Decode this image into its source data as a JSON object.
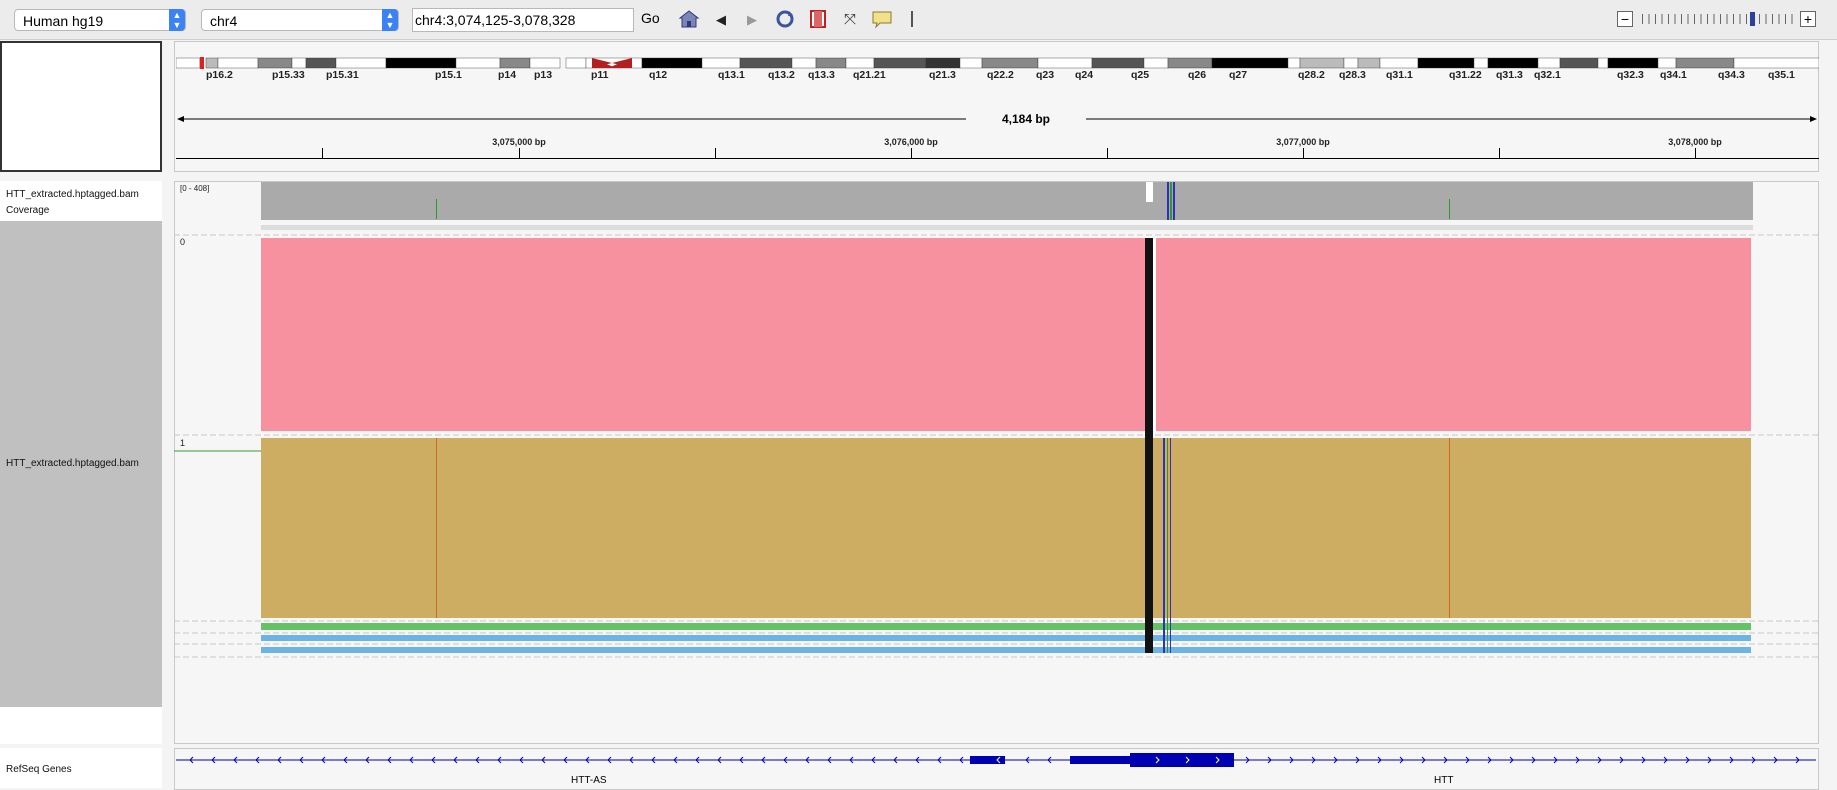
{
  "toolbar": {
    "genome": "Human hg19",
    "chromosome": "chr4",
    "locus": "chr4:3,074,125-3,078,328",
    "go_label": "Go"
  },
  "ruler": {
    "span": "4,184 bp",
    "ticks": [
      "3,075,000 bp",
      "3,076,000 bp",
      "3,077,000 bp",
      "3,078,000 bp"
    ]
  },
  "cytobands": [
    "p16.2",
    "p15.33",
    "p15.31",
    "p15.1",
    "p14",
    "p13",
    "p11",
    "q12",
    "q13.1",
    "q13.2",
    "q13.3",
    "q21.21",
    "q21.3",
    "q22.2",
    "q23",
    "q24",
    "q25",
    "q26",
    "q27",
    "q28.2",
    "q28.3",
    "q31.1",
    "q31.22",
    "q31.3",
    "q32.1",
    "q32.3",
    "q34.1",
    "q34.3",
    "q35.1"
  ],
  "tracks": {
    "coverage_name": "HTT_extracted.hptagged.bam Coverage",
    "coverage_range": "[0 - 408]",
    "alignment_name": "HTT_extracted.hptagged.bam",
    "group_0": "0",
    "group_1": "1",
    "genes_name": "RefSeq Genes"
  },
  "genes": [
    "HTT-AS",
    "HTT"
  ],
  "colors": {
    "haplotype_0": "#f7919f",
    "haplotype_1": "#cdad62",
    "coverage": "#aaaaaa",
    "gene": "#0000b3",
    "read_green": "#66c266",
    "read_blue": "#6cb4e4"
  }
}
